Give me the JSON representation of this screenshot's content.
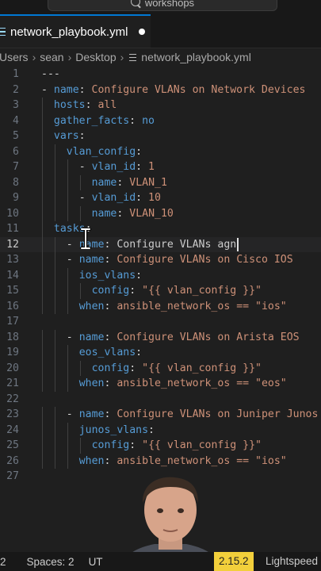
{
  "title_bar": {
    "search_text": "workshops"
  },
  "tab": {
    "filename": "network_playbook.yml"
  },
  "breadcrumb": [
    "Users",
    "sean",
    "Desktop",
    "network_playbook.yml"
  ],
  "editor": {
    "current_line": 12,
    "lines": [
      {
        "n": "1",
        "indent": 0,
        "tokens": [
          [
            "p",
            "---"
          ]
        ]
      },
      {
        "n": "2",
        "indent": 0,
        "tokens": [
          [
            "p",
            "- "
          ],
          [
            "k",
            "name"
          ],
          [
            "p",
            ": "
          ],
          [
            "s",
            "Configure VLANs on Network Devices"
          ]
        ]
      },
      {
        "n": "3",
        "indent": 1,
        "tokens": [
          [
            "k",
            "hosts"
          ],
          [
            "p",
            ": "
          ],
          [
            "s",
            "all"
          ]
        ]
      },
      {
        "n": "4",
        "indent": 1,
        "tokens": [
          [
            "k",
            "gather_facts"
          ],
          [
            "p",
            ": "
          ],
          [
            "k",
            "no"
          ]
        ]
      },
      {
        "n": "5",
        "indent": 1,
        "tokens": [
          [
            "k",
            "vars"
          ],
          [
            "p",
            ":"
          ]
        ]
      },
      {
        "n": "6",
        "indent": 2,
        "tokens": [
          [
            "k",
            "vlan_config"
          ],
          [
            "p",
            ":"
          ]
        ]
      },
      {
        "n": "7",
        "indent": 3,
        "tokens": [
          [
            "p",
            "- "
          ],
          [
            "k",
            "vlan_id"
          ],
          [
            "p",
            ": "
          ],
          [
            "s",
            "1"
          ]
        ]
      },
      {
        "n": "8",
        "indent": 4,
        "tokens": [
          [
            "k",
            "name"
          ],
          [
            "p",
            ": "
          ],
          [
            "s",
            "VLAN_1"
          ]
        ]
      },
      {
        "n": "9",
        "indent": 3,
        "tokens": [
          [
            "p",
            "- "
          ],
          [
            "k",
            "vlan_id"
          ],
          [
            "p",
            ": "
          ],
          [
            "s",
            "10"
          ]
        ]
      },
      {
        "n": "10",
        "indent": 4,
        "tokens": [
          [
            "k",
            "name"
          ],
          [
            "p",
            ": "
          ],
          [
            "s",
            "VLAN_10"
          ]
        ]
      },
      {
        "n": "11",
        "indent": 1,
        "tokens": [
          [
            "k",
            "tasks"
          ],
          [
            "p",
            ":"
          ]
        ]
      },
      {
        "n": "12",
        "indent": 2,
        "tokens": [
          [
            "p",
            "- "
          ],
          [
            "k",
            "name"
          ],
          [
            "p",
            ": "
          ],
          [
            "d",
            "Configure VLANs agn"
          ]
        ]
      },
      {
        "n": "13",
        "indent": 2,
        "tokens": [
          [
            "p",
            "- "
          ],
          [
            "k",
            "name"
          ],
          [
            "p",
            ": "
          ],
          [
            "s",
            "Configure VLANs on Cisco IOS"
          ]
        ]
      },
      {
        "n": "14",
        "indent": 3,
        "tokens": [
          [
            "k",
            "ios_vlans"
          ],
          [
            "p",
            ":"
          ]
        ]
      },
      {
        "n": "15",
        "indent": 4,
        "tokens": [
          [
            "k",
            "config"
          ],
          [
            "p",
            ": "
          ],
          [
            "s",
            "\"{{ vlan_config }}\""
          ]
        ]
      },
      {
        "n": "16",
        "indent": 3,
        "tokens": [
          [
            "k",
            "when"
          ],
          [
            "p",
            ": "
          ],
          [
            "s",
            "ansible_network_os == \"ios\""
          ]
        ]
      },
      {
        "n": "17",
        "indent": 0,
        "tokens": []
      },
      {
        "n": "18",
        "indent": 2,
        "tokens": [
          [
            "p",
            "- "
          ],
          [
            "k",
            "name"
          ],
          [
            "p",
            ": "
          ],
          [
            "s",
            "Configure VLANs on Arista EOS"
          ]
        ]
      },
      {
        "n": "19",
        "indent": 3,
        "tokens": [
          [
            "k",
            "eos_vlans"
          ],
          [
            "p",
            ":"
          ]
        ]
      },
      {
        "n": "20",
        "indent": 4,
        "tokens": [
          [
            "k",
            "config"
          ],
          [
            "p",
            ": "
          ],
          [
            "s",
            "\"{{ vlan_config }}\""
          ]
        ]
      },
      {
        "n": "21",
        "indent": 3,
        "tokens": [
          [
            "k",
            "when"
          ],
          [
            "p",
            ": "
          ],
          [
            "s",
            "ansible_network_os == \"eos\""
          ]
        ]
      },
      {
        "n": "22",
        "indent": 0,
        "tokens": []
      },
      {
        "n": "23",
        "indent": 2,
        "tokens": [
          [
            "p",
            "- "
          ],
          [
            "k",
            "name"
          ],
          [
            "p",
            ": "
          ],
          [
            "s",
            "Configure VLANs on Juniper Junos"
          ]
        ]
      },
      {
        "n": "24",
        "indent": 3,
        "tokens": [
          [
            "k",
            "junos_vlans"
          ],
          [
            "p",
            ":"
          ]
        ]
      },
      {
        "n": "25",
        "indent": 4,
        "tokens": [
          [
            "k",
            "config"
          ],
          [
            "p",
            ": "
          ],
          [
            "s",
            "\"{{ vlan_config }}\""
          ]
        ]
      },
      {
        "n": "26",
        "indent": 3,
        "tokens": [
          [
            "k",
            "when"
          ],
          [
            "p",
            ": "
          ],
          [
            "s",
            "ansible_network_os == \"ios\""
          ]
        ]
      },
      {
        "n": "27",
        "indent": 0,
        "tokens": []
      }
    ]
  },
  "status_bar": {
    "line_col_fragment": "2",
    "spaces": "Spaces: 2",
    "encoding_fragment": "UT",
    "version": "2.15.2",
    "extension": "Lightspeed"
  },
  "colors": {
    "keyword": "#569cd6",
    "string": "#ce9178",
    "accent_tab": "#0078d4",
    "version_badge": "#f2cf3b"
  },
  "icons": [
    "search-icon",
    "file-lines-icon",
    "dirty-indicator-icon",
    "chevron-right-icon",
    "text-cursor-icon"
  ]
}
